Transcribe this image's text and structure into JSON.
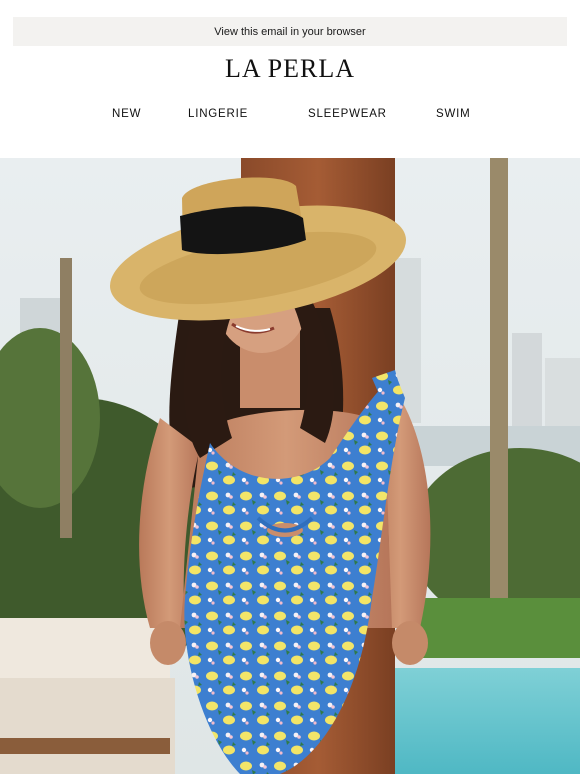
{
  "email": {
    "browser_link": "View this email in your browser",
    "brand": "LA PERLA",
    "nav": {
      "new": "NEW",
      "lingerie": "LINGERIE",
      "sleepwear": "SLEEPWEAR",
      "swim": "SWIM"
    }
  }
}
